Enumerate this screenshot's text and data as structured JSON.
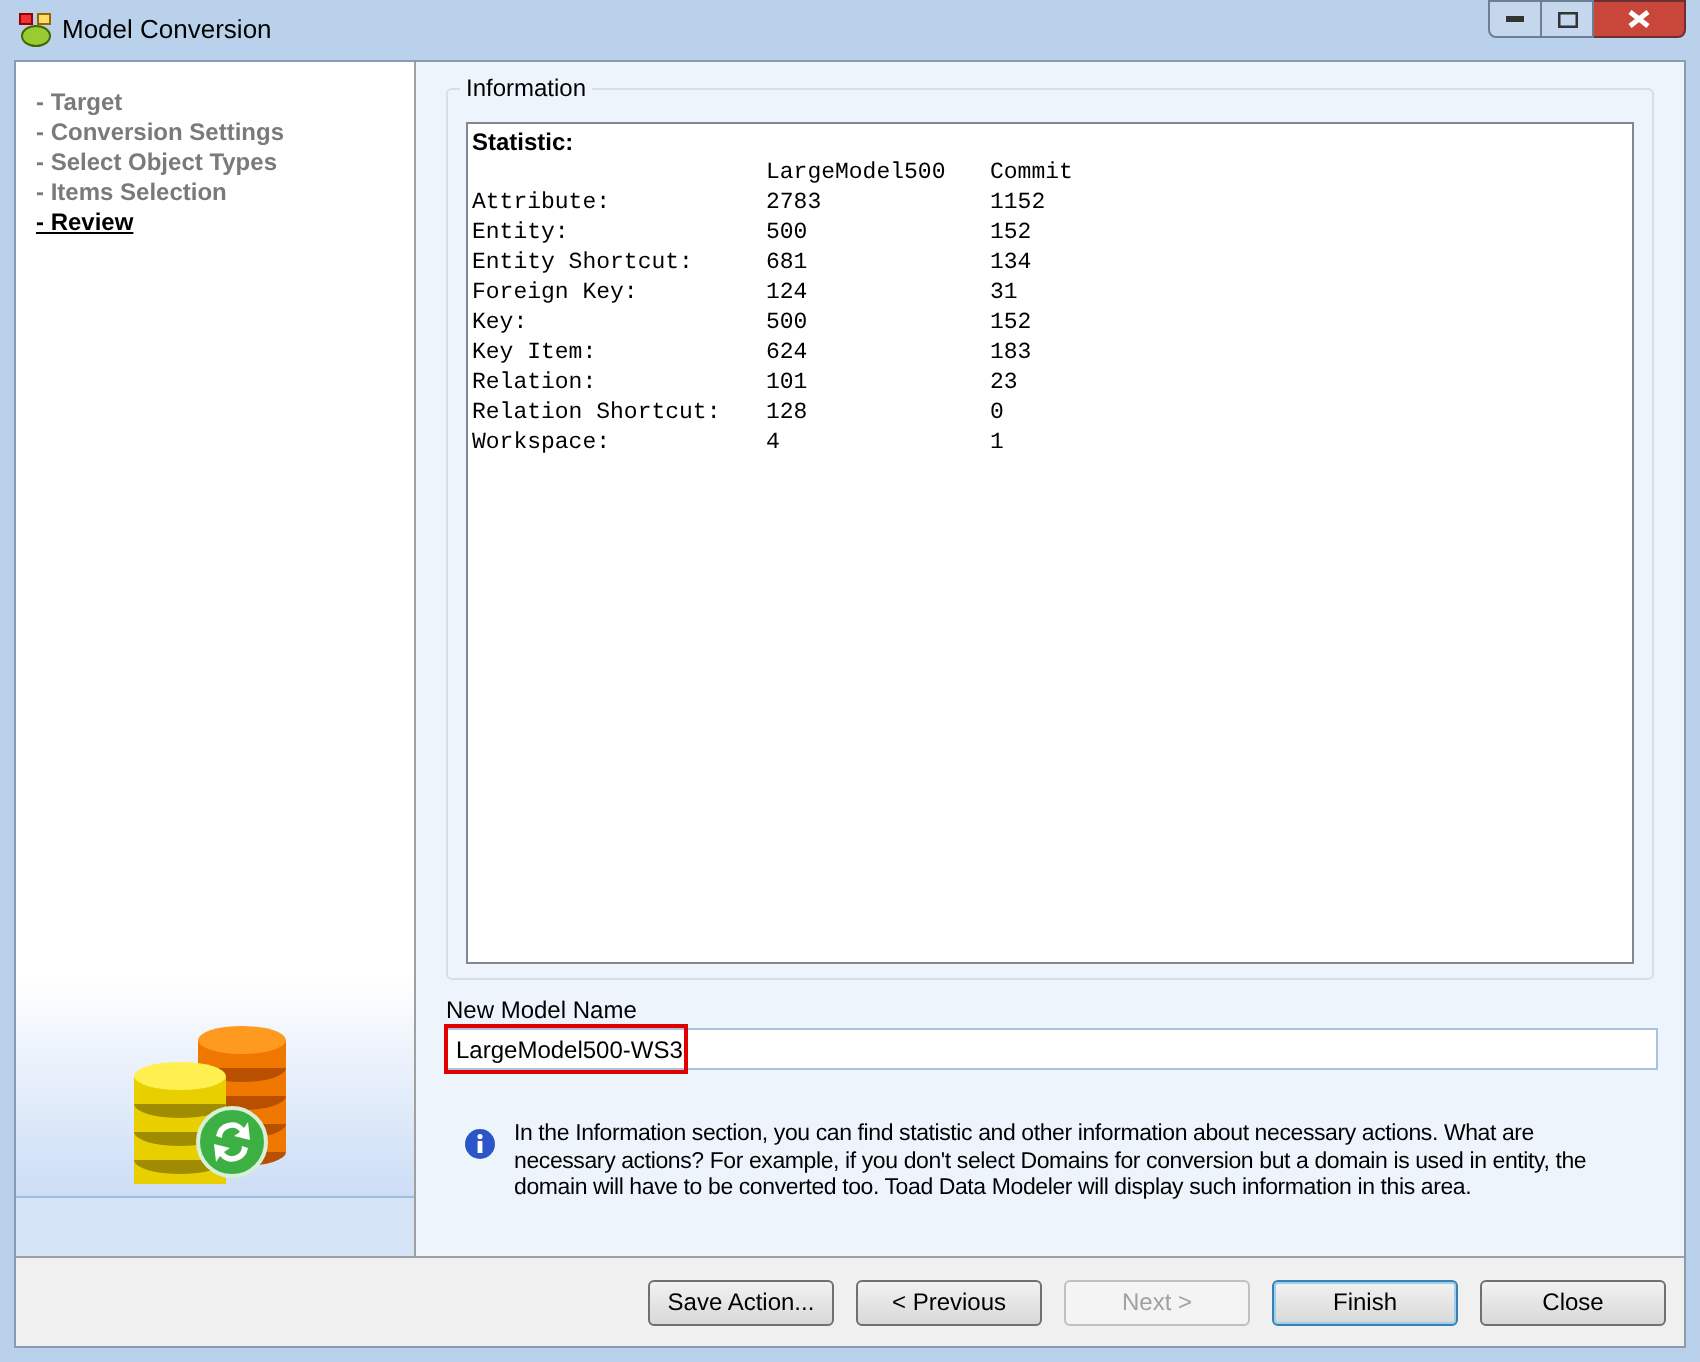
{
  "window": {
    "title": "Model Conversion"
  },
  "steps": [
    {
      "label": "- Target",
      "selected": false
    },
    {
      "label": "- Conversion Settings",
      "selected": false
    },
    {
      "label": "- Select Object Types",
      "selected": false
    },
    {
      "label": "- Items Selection",
      "selected": false
    },
    {
      "label": "- Review",
      "selected": true
    }
  ],
  "information": {
    "title": "Information",
    "heading": "Statistic:",
    "columns": [
      "LargeModel500",
      "Commit"
    ],
    "rows": [
      {
        "label": "Attribute:",
        "values": [
          "2783",
          "1152"
        ]
      },
      {
        "label": "Entity:",
        "values": [
          "500",
          "152"
        ]
      },
      {
        "label": "Entity Shortcut:",
        "values": [
          "681",
          "134"
        ]
      },
      {
        "label": "Foreign Key:",
        "values": [
          "124",
          "31"
        ]
      },
      {
        "label": "Key:",
        "values": [
          "500",
          "152"
        ]
      },
      {
        "label": "Key Item:",
        "values": [
          "624",
          "183"
        ]
      },
      {
        "label": "Relation:",
        "values": [
          "101",
          "23"
        ]
      },
      {
        "label": "Relation Shortcut:",
        "values": [
          "128",
          "0"
        ]
      },
      {
        "label": "Workspace:",
        "values": [
          "4",
          "1"
        ]
      }
    ]
  },
  "new_model_name": {
    "label": "New Model Name",
    "value": "LargeModel500-WS3",
    "highlighted": true
  },
  "hint": "In the Information section, you can find statistic and other information about necessary actions. What are necessary actions? For example, if you don't select Domains for conversion but a domain is used in entity, the domain will have to be converted too. Toad Data Modeler will display such information in this area.",
  "buttons": [
    {
      "label": "Save Action...",
      "disabled": false,
      "default": false
    },
    {
      "label": "< Previous",
      "disabled": false,
      "default": false
    },
    {
      "label": "Next >",
      "disabled": true,
      "default": false
    },
    {
      "label": "Finish",
      "disabled": false,
      "default": true
    },
    {
      "label": "Close",
      "disabled": false,
      "default": false
    }
  ]
}
